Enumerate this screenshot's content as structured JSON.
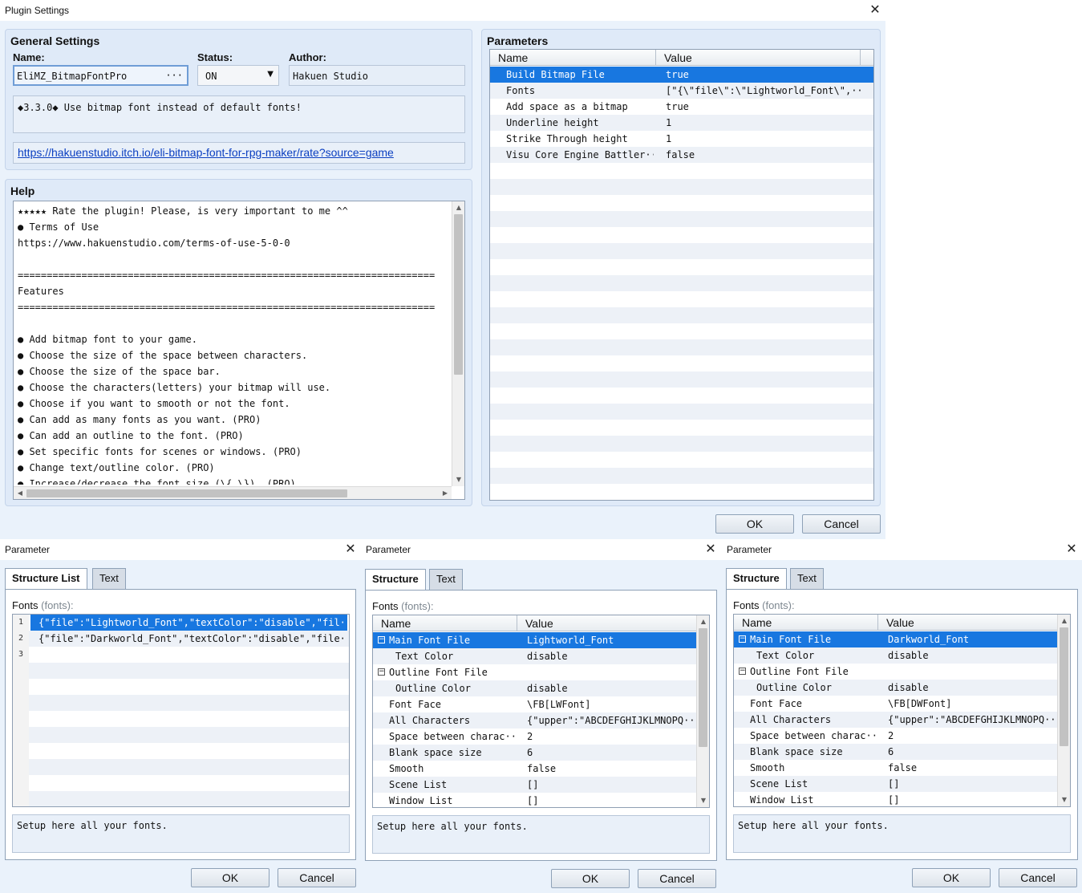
{
  "plugin_settings": {
    "title": "Plugin Settings",
    "general": {
      "title": "General Settings",
      "name_label": "Name:",
      "name_value": "EliMZ_BitmapFontPro",
      "name_button": "···",
      "status_label": "Status:",
      "status_value": "ON",
      "author_label": "Author:",
      "author_value": "Hakuen Studio",
      "description": "◆3.3.0◆ Use bitmap font instead of default fonts!",
      "url": "https://hakuenstudio.itch.io/eli-bitmap-font-for-rpg-maker/rate?source=game"
    },
    "help": {
      "title": "Help",
      "lines": [
        "★★★★★ Rate the plugin! Please, is very important to me ^^",
        "● Terms of Use",
        "https://www.hakuenstudio.com/terms-of-use-5-0-0",
        "",
        "========================================================================",
        "Features",
        "========================================================================",
        "",
        "● Add bitmap font to your game.",
        "● Choose the size of the space between characters.",
        "● Choose the size of the space bar.",
        "● Choose the characters(letters) your bitmap will use.",
        "● Choose if you want to smooth or not the font.",
        "● Can add as many fonts as you want. (PRO)",
        "● Can add an outline to the font. (PRO)",
        "● Set specific fonts for scenes or windows. (PRO)",
        "● Change text/outline color. (PRO)",
        "● Increase/decrease the font size (\\{ \\}). (PRO)"
      ]
    },
    "parameters": {
      "title": "Parameters",
      "col_name": "Name",
      "col_value": "Value",
      "rows": [
        {
          "name": "Build Bitmap File",
          "value": "true"
        },
        {
          "name": "Fonts",
          "value": "[\"{\\\"file\\\":\\\"Lightworld_Font\\\",···"
        },
        {
          "name": "Add space as a bitmap",
          "value": "true"
        },
        {
          "name": "Underline height",
          "value": "1"
        },
        {
          "name": "Strike Through height",
          "value": "1"
        },
        {
          "name": "Visu Core Engine Battler···",
          "value": "false"
        }
      ]
    },
    "ok": "OK",
    "cancel": "Cancel"
  },
  "param1": {
    "title": "Parameter",
    "tab1": "Structure List",
    "tab2": "Text",
    "field_label": "Fonts",
    "field_key": "(fonts):",
    "list": [
      {
        "num": "1",
        "text": "{\"file\":\"Lightworld_Font\",\"textColor\":\"disable\",\"fil···"
      },
      {
        "num": "2",
        "text": "{\"file\":\"Darkworld_Font\",\"textColor\":\"disable\",\"file···"
      },
      {
        "num": "3",
        "text": ""
      }
    ],
    "description": "Setup here all your fonts.",
    "ok": "OK",
    "cancel": "Cancel"
  },
  "param2": {
    "title": "Parameter",
    "tab1": "Structure",
    "tab2": "Text",
    "field_label": "Fonts",
    "field_key": "(fonts):",
    "col_name": "Name",
    "col_value": "Value",
    "rows": [
      {
        "toggle": "−",
        "name": "Main Font File",
        "value": "Lightworld_Font"
      },
      {
        "toggle": "",
        "name": "Text Color",
        "value": "disable"
      },
      {
        "toggle": "−",
        "name": "Outline Font File",
        "value": ""
      },
      {
        "toggle": "",
        "name": "Outline Color",
        "value": "disable"
      },
      {
        "toggle": "",
        "name": "Font Face",
        "value": "\\FB[LWFont]"
      },
      {
        "toggle": "",
        "name": "All Characters",
        "value": "{\"upper\":\"ABCDEFGHIJKLMNOPQ···"
      },
      {
        "toggle": "",
        "name": "Space between charac···",
        "value": "2"
      },
      {
        "toggle": "",
        "name": "Blank space size",
        "value": "6"
      },
      {
        "toggle": "",
        "name": "Smooth",
        "value": "false"
      },
      {
        "toggle": "",
        "name": "Scene List",
        "value": "[]"
      },
      {
        "toggle": "",
        "name": "Window List",
        "value": "[]"
      }
    ],
    "description": "Setup here all your fonts.",
    "ok": "OK",
    "cancel": "Cancel"
  },
  "param3": {
    "title": "Parameter",
    "tab1": "Structure",
    "tab2": "Text",
    "field_label": "Fonts",
    "field_key": "(fonts):",
    "col_name": "Name",
    "col_value": "Value",
    "rows": [
      {
        "toggle": "−",
        "name": "Main Font File",
        "value": "Darkworld_Font"
      },
      {
        "toggle": "",
        "name": "Text Color",
        "value": "disable"
      },
      {
        "toggle": "−",
        "name": "Outline Font File",
        "value": ""
      },
      {
        "toggle": "",
        "name": "Outline Color",
        "value": "disable"
      },
      {
        "toggle": "",
        "name": "Font Face",
        "value": "\\FB[DWFont]"
      },
      {
        "toggle": "",
        "name": "All Characters",
        "value": "{\"upper\":\"ABCDEFGHIJKLMNOPQ···"
      },
      {
        "toggle": "",
        "name": "Space between charac···",
        "value": "2"
      },
      {
        "toggle": "",
        "name": "Blank space size",
        "value": "6"
      },
      {
        "toggle": "",
        "name": "Smooth",
        "value": "false"
      },
      {
        "toggle": "",
        "name": "Scene List",
        "value": "[]"
      },
      {
        "toggle": "",
        "name": "Window List",
        "value": "[]"
      }
    ],
    "description": "Setup here all your fonts.",
    "ok": "OK",
    "cancel": "Cancel"
  }
}
